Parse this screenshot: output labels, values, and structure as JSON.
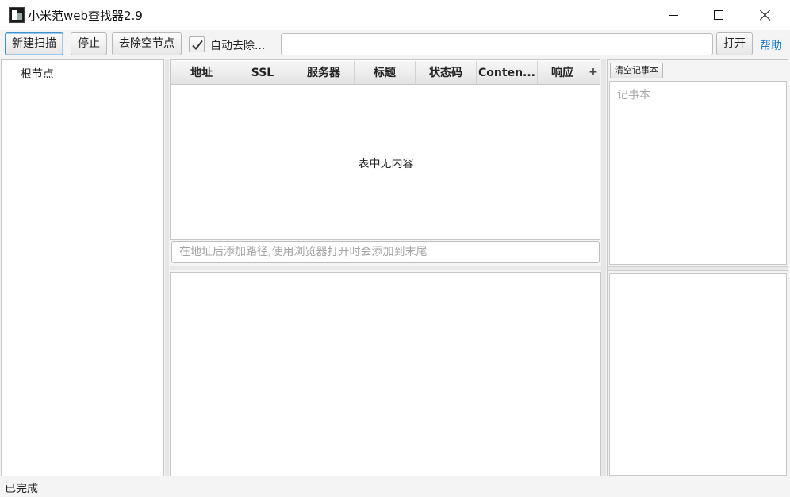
{
  "window": {
    "title": "小米范web查找器2.9"
  },
  "toolbar": {
    "new_scan": "新建扫描",
    "stop": "停止",
    "remove_empty": "去除空节点",
    "auto_remove_checked": true,
    "auto_remove_label": "自动去除...",
    "url_value": "",
    "open": "打开",
    "help": "帮助"
  },
  "tree": {
    "root_label": "根节点"
  },
  "table": {
    "columns": [
      "地址",
      "SSL",
      "服务器",
      "标题",
      "状态码",
      "Conten...",
      "响应"
    ],
    "add_column": "+",
    "empty_text": "表中无内容",
    "rows": []
  },
  "path_input": {
    "placeholder": "在地址后添加路径,使用浏览器打开时会添加到末尾"
  },
  "notes": {
    "clear_button": "清空记事本",
    "placeholder": "记事本"
  },
  "status": {
    "text": "已完成"
  },
  "colors": {
    "accent": "#3e92d0",
    "link": "#1a7bd1",
    "background": "#f4f4f4"
  }
}
